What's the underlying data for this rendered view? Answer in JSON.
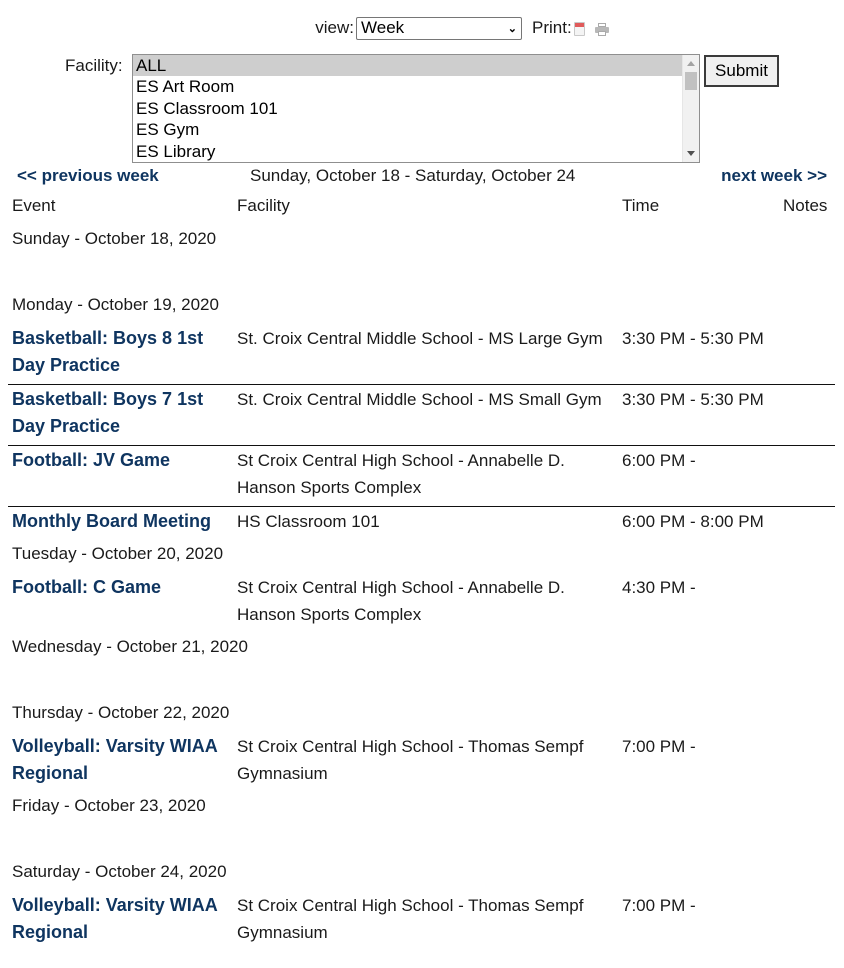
{
  "toolbar": {
    "view_label": "view:",
    "view_value": "Week",
    "print_label": "Print:",
    "print_icons": [
      "pdf-icon",
      "printer-icon"
    ]
  },
  "facility": {
    "label": "Facility:",
    "options": [
      "ALL",
      "ES Art Room",
      "ES Classroom 101",
      "ES Gym",
      "ES Library"
    ],
    "selected": "ALL",
    "submit_label": "Submit"
  },
  "nav": {
    "prev_label": "<< previous week",
    "range": "Sunday, October 18 - Saturday, October 24",
    "next_label": "next week >>"
  },
  "columns": {
    "event": "Event",
    "facility": "Facility",
    "time": "Time",
    "notes": "Notes"
  },
  "days": [
    {
      "label": "Sunday - October 18, 2020",
      "events": []
    },
    {
      "label": "Monday - October 19, 2020",
      "events": [
        {
          "title": "Basketball: Boys 8 1st Day Practice",
          "facility": "St. Croix Central Middle School - MS Large Gym",
          "time": "3:30 PM - 5:30 PM",
          "notes": ""
        },
        {
          "title": "Basketball: Boys 7 1st Day Practice",
          "facility": "St. Croix Central Middle School - MS Small Gym",
          "time": "3:30 PM - 5:30 PM",
          "notes": ""
        },
        {
          "title": "Football: JV Game",
          "facility": "St Croix Central High School - Annabelle D. Hanson Sports Complex",
          "time": "6:00 PM -",
          "notes": ""
        },
        {
          "title": "Monthly Board Meeting",
          "facility": "HS Classroom 101",
          "time": "6:00 PM - 8:00 PM",
          "notes": ""
        }
      ]
    },
    {
      "label": "Tuesday - October 20, 2020",
      "events": [
        {
          "title": "Football: C Game",
          "facility": "St Croix Central High School - Annabelle D. Hanson Sports Complex",
          "time": "4:30 PM -",
          "notes": ""
        }
      ]
    },
    {
      "label": "Wednesday - October 21, 2020",
      "events": []
    },
    {
      "label": "Thursday - October 22, 2020",
      "events": [
        {
          "title": "Volleyball: Varsity WIAA Regional",
          "facility": "St Croix Central High School - Thomas Sempf Gymnasium",
          "time": "7:00 PM -",
          "notes": ""
        }
      ]
    },
    {
      "label": "Friday - October 23, 2020",
      "events": []
    },
    {
      "label": "Saturday - October 24, 2020",
      "events": [
        {
          "title": "Volleyball: Varsity WIAA Regional",
          "facility": "St Croix Central High School - Thomas Sempf Gymnasium",
          "time": "7:00 PM -",
          "notes": ""
        }
      ]
    }
  ],
  "colors": {
    "link": "#0f3560",
    "text": "#1a1a1a",
    "divider": "#111111",
    "selected_option_bg": "#cecece"
  }
}
